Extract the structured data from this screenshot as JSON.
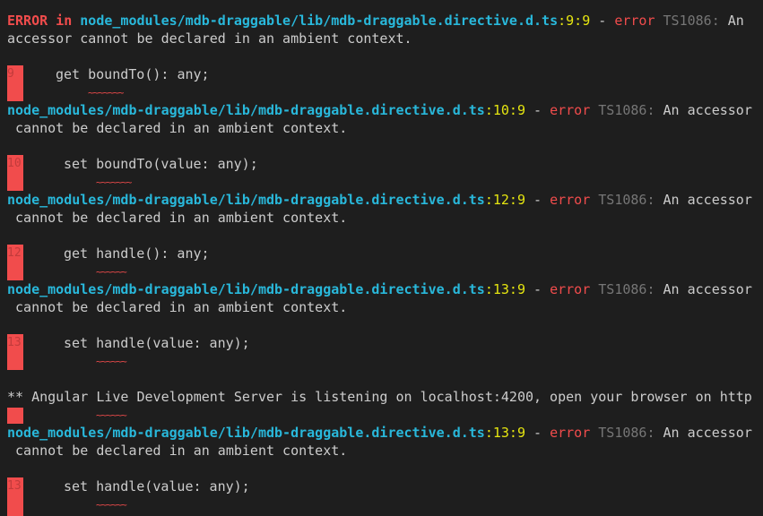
{
  "terminal": {
    "first_error": {
      "prefix": "ERROR in ",
      "path": "node_modules/mdb-draggable/lib/mdb-draggable.directive.d.ts",
      "loc": ":9:9",
      "sep": " - ",
      "error_word": "error",
      "code": " TS1086:",
      "msg_first": " An",
      "msg_second": "accessor cannot be declared in an ambient context.",
      "gutter": "9",
      "source": "get boundTo(): any;",
      "squiggle": "~~~~~~~"
    },
    "errors": [
      {
        "path": "node_modules/mdb-draggable/lib/mdb-draggable.directive.d.ts",
        "loc": ":10:9",
        "sep": " - ",
        "error_word": "error",
        "code": " TS1086:",
        "msg_first": " An accessor",
        "msg_second": " cannot be declared in an ambient context.",
        "gutter": "10",
        "source": "set boundTo(value: any);",
        "squiggle": "~~~~~~~"
      },
      {
        "path": "node_modules/mdb-draggable/lib/mdb-draggable.directive.d.ts",
        "loc": ":12:9",
        "sep": " - ",
        "error_word": "error",
        "code": " TS1086:",
        "msg_first": " An accessor",
        "msg_second": " cannot be declared in an ambient context.",
        "gutter": "12",
        "source": "get handle(): any;",
        "squiggle": "~~~~~~"
      },
      {
        "path": "node_modules/mdb-draggable/lib/mdb-draggable.directive.d.ts",
        "loc": ":13:9",
        "sep": " - ",
        "error_word": "error",
        "code": " TS1086:",
        "msg_first": " An accessor",
        "msg_second": " cannot be declared in an ambient context.",
        "gutter": "13",
        "source": "set handle(value: any);",
        "squiggle": "~~~~~~"
      }
    ],
    "server_msg": "** Angular Live Development Server is listening on localhost:4200, open your browser on http",
    "server_squiggle": "~~~~~~",
    "last_error": {
      "path": "node_modules/mdb-draggable/lib/mdb-draggable.directive.d.ts",
      "loc": ":13:9",
      "sep": " - ",
      "error_word": "error",
      "code": " TS1086:",
      "msg_first": " An accessor",
      "msg_second": " cannot be declared in an ambient context.",
      "gutter": "13",
      "source": "set handle(value: any);",
      "squiggle": "~~~~~~"
    },
    "colors": {
      "background": "#1e1e1e",
      "error_red": "#f14c4c",
      "path_cyan": "#29b8db",
      "location_yellow": "#e5e510",
      "code_gray": "#767676",
      "text": "#cccccc"
    }
  }
}
